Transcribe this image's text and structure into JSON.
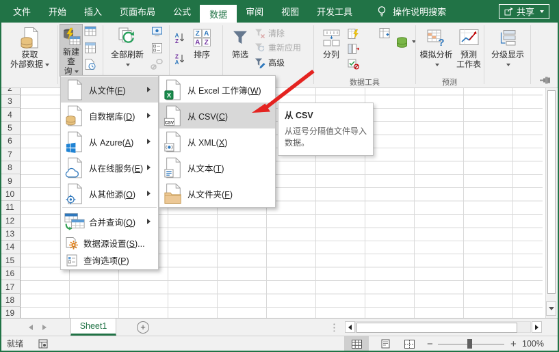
{
  "tabs": [
    "文件",
    "开始",
    "插入",
    "页面布局",
    "公式",
    "数据",
    "审阅",
    "视图",
    "开发工具"
  ],
  "topbar": {
    "search": "操作说明搜索",
    "share": "共享"
  },
  "ribbon": {
    "get_external_line1": "获取",
    "get_external_line2": "外部数据",
    "new_query_line1": "新建查",
    "new_query_line2": "询",
    "refresh_all": "全部刷新",
    "sort": "排序",
    "filter": "筛选",
    "clear": "清除",
    "reapply": "重新应用",
    "advanced": "高级",
    "text_to_columns": "分列",
    "what_if": "模拟分析",
    "forecast_line1": "预测",
    "forecast_line2": "工作表",
    "outline": "分级显示",
    "label_data_tools": "数据工具",
    "label_forecast": "预测"
  },
  "query_menu": {
    "items": [
      {
        "pre": "从文件(",
        "accel": "F",
        "post": ")"
      },
      {
        "pre": "自数据库(",
        "accel": "D",
        "post": ")"
      },
      {
        "pre": "从 Azure(",
        "accel": "A",
        "post": ")"
      },
      {
        "pre": "从在线服务(",
        "accel": "E",
        "post": ")"
      },
      {
        "pre": "从其他源(",
        "accel": "O",
        "post": ")"
      },
      {
        "pre": "合并查询(",
        "accel": "Q",
        "post": ")"
      },
      {
        "pre": "数据源设置(",
        "accel": "S",
        "post": ")..."
      },
      {
        "pre": "查询选项(",
        "accel": "P",
        "post": ")"
      }
    ]
  },
  "file_submenu": {
    "items": [
      {
        "pre": "从 Excel 工作簿(",
        "accel": "W",
        "post": ")"
      },
      {
        "pre": "从 CSV(",
        "accel": "C",
        "post": ")"
      },
      {
        "pre": "从 XML(",
        "accel": "X",
        "post": ")"
      },
      {
        "pre": "从文本(",
        "accel": "T",
        "post": ")"
      },
      {
        "pre": "从文件夹(",
        "accel": "F",
        "post": ")"
      }
    ]
  },
  "tooltip": {
    "title": "从 CSV",
    "body_line1": "从逗号分隔值文件导入",
    "body_line2": "数据。"
  },
  "grid_rows": [
    "2",
    "3",
    "4",
    "5",
    "6",
    "7",
    "8",
    "9",
    "10",
    "11",
    "12",
    "13",
    "14",
    "15",
    "16",
    "17",
    "18",
    "19"
  ],
  "sheet": {
    "name": "Sheet1"
  },
  "status": {
    "ready": "就绪",
    "zoom_level": "100%"
  },
  "colors": {
    "brand_green": "#217346",
    "menu_highlight": "#d8d8d8",
    "arrow_red": "#e42320"
  }
}
